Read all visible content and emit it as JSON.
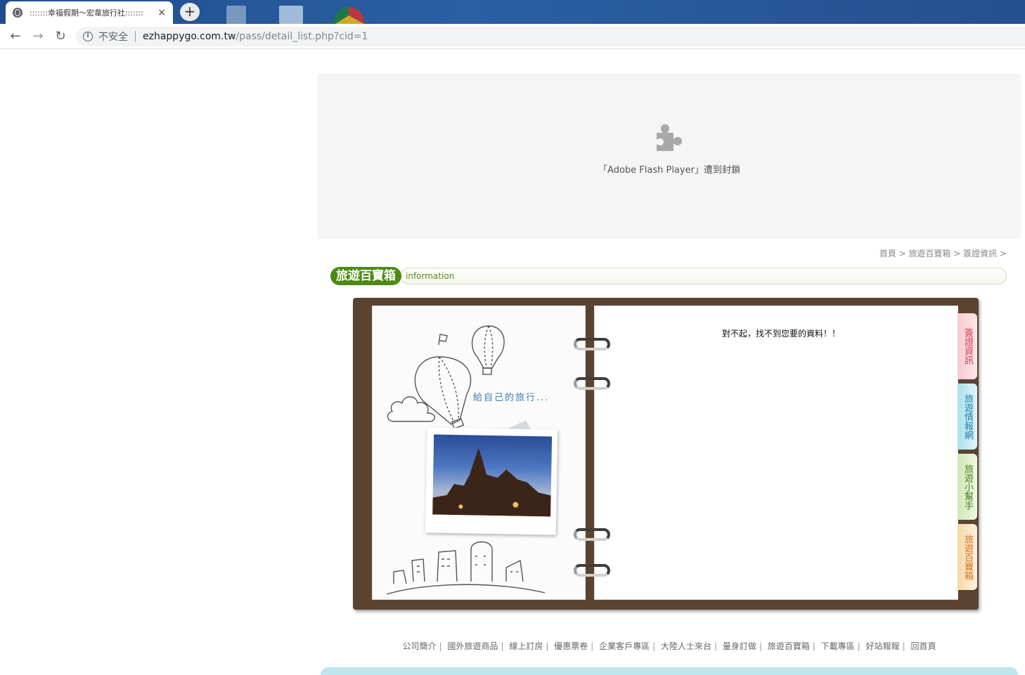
{
  "browser": {
    "tab_title": ":::::::幸福假期～宏韋旅行社:::::::",
    "tab_close": "×",
    "new_tab": "+",
    "back": "←",
    "forward": "→",
    "reload": "↻",
    "info_glyph": "i",
    "insecure_label": "不安全",
    "url_host": "ezhappygo.com.tw",
    "url_path": "/pass/detail_list.php?cid=1"
  },
  "flash": {
    "blocked_message": "「Adobe Flash Player」遭到封鎖"
  },
  "breadcrumb": "首頁 > 旅遊百寶箱 > 簽證資訊 >",
  "section": {
    "title": "旅遊百寶箱",
    "subtitle": "information"
  },
  "notebook": {
    "decor_text": "給自己的旅行...",
    "not_found": "對不起，找不到您要的資料！！",
    "tabs": [
      {
        "label": "簽證資訊"
      },
      {
        "label": "旅遊情報網"
      },
      {
        "label": "旅遊小幫手"
      },
      {
        "label": "旅遊百寶箱"
      }
    ]
  },
  "footer": {
    "links": [
      {
        "label": "公司簡介"
      },
      {
        "label": "國外旅遊商品"
      },
      {
        "label": "線上訂房"
      },
      {
        "label": "優惠票卷"
      },
      {
        "label": "企業客戶專區"
      },
      {
        "label": "大陸人士來台"
      },
      {
        "label": "量身訂做"
      },
      {
        "label": "旅遊百寶箱"
      },
      {
        "label": "下載專區"
      },
      {
        "label": "好站報報"
      },
      {
        "label": "回首頁"
      }
    ]
  },
  "colors": {
    "tabstrip": "#2b5fa5",
    "section_green": "#4b8a15",
    "binder_brown": "#5b4332"
  }
}
